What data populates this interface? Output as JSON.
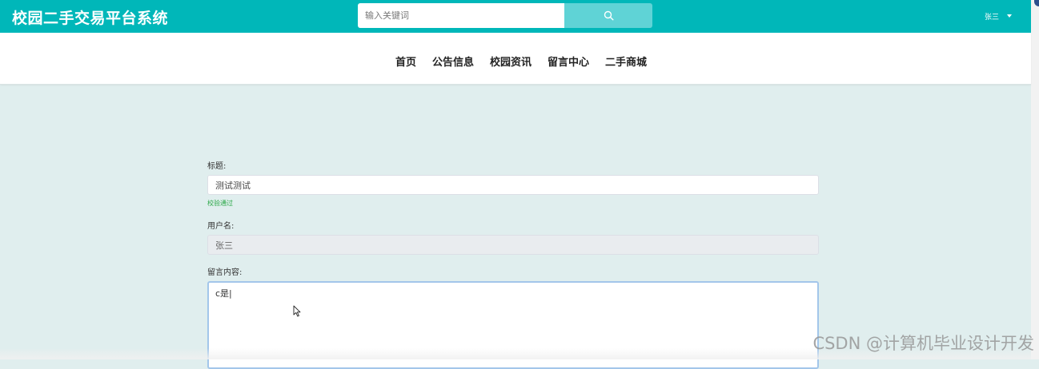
{
  "header": {
    "site_title": "校园二手交易平台系统",
    "search": {
      "placeholder": "输入关键词",
      "value": "",
      "icon": "search-icon"
    },
    "user": {
      "name": "张三",
      "icon": "caret-down-icon"
    }
  },
  "nav": {
    "items": [
      {
        "label": "首页"
      },
      {
        "label": "公告信息"
      },
      {
        "label": "校园资讯"
      },
      {
        "label": "留言中心"
      },
      {
        "label": "二手商城"
      }
    ]
  },
  "form": {
    "title": {
      "label": "标题:",
      "value": "测试测试",
      "validation": "校验通过"
    },
    "username": {
      "label": "用户名:",
      "value": "张三"
    },
    "content": {
      "label": "留言内容:",
      "value": "c是|"
    }
  },
  "watermark": "CSDN @计算机毕业设计开发",
  "colors": {
    "header_bg": "#00b7b9",
    "search_button_bg": "#5fd3d6",
    "page_bg": "#e0eeee",
    "valid_green": "#28a745",
    "textarea_focus_border": "#a3c6ea"
  }
}
